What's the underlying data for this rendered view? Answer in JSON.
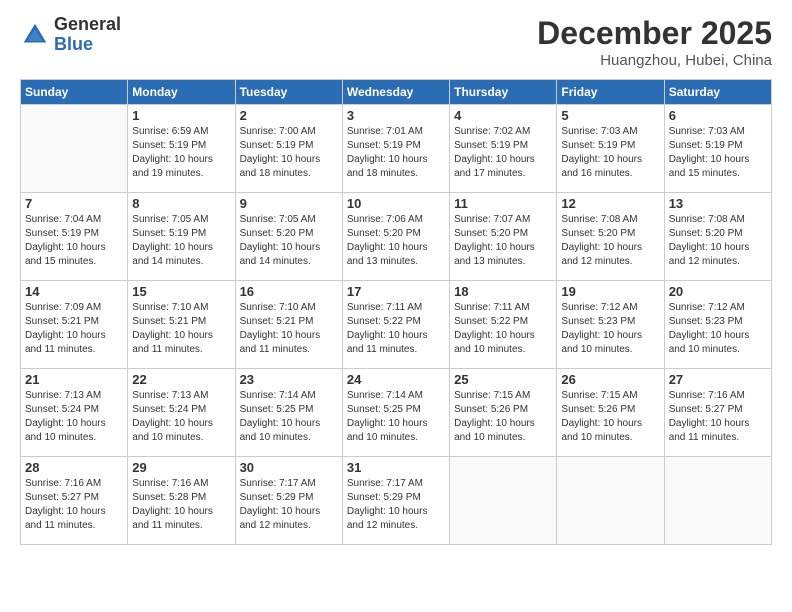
{
  "logo": {
    "general": "General",
    "blue": "Blue"
  },
  "header": {
    "month": "December 2025",
    "location": "Huangzhou, Hubei, China"
  },
  "days_of_week": [
    "Sunday",
    "Monday",
    "Tuesday",
    "Wednesday",
    "Thursday",
    "Friday",
    "Saturday"
  ],
  "weeks": [
    [
      {
        "num": "",
        "info": ""
      },
      {
        "num": "1",
        "info": "Sunrise: 6:59 AM\nSunset: 5:19 PM\nDaylight: 10 hours\nand 19 minutes."
      },
      {
        "num": "2",
        "info": "Sunrise: 7:00 AM\nSunset: 5:19 PM\nDaylight: 10 hours\nand 18 minutes."
      },
      {
        "num": "3",
        "info": "Sunrise: 7:01 AM\nSunset: 5:19 PM\nDaylight: 10 hours\nand 18 minutes."
      },
      {
        "num": "4",
        "info": "Sunrise: 7:02 AM\nSunset: 5:19 PM\nDaylight: 10 hours\nand 17 minutes."
      },
      {
        "num": "5",
        "info": "Sunrise: 7:03 AM\nSunset: 5:19 PM\nDaylight: 10 hours\nand 16 minutes."
      },
      {
        "num": "6",
        "info": "Sunrise: 7:03 AM\nSunset: 5:19 PM\nDaylight: 10 hours\nand 15 minutes."
      }
    ],
    [
      {
        "num": "7",
        "info": "Sunrise: 7:04 AM\nSunset: 5:19 PM\nDaylight: 10 hours\nand 15 minutes."
      },
      {
        "num": "8",
        "info": "Sunrise: 7:05 AM\nSunset: 5:19 PM\nDaylight: 10 hours\nand 14 minutes."
      },
      {
        "num": "9",
        "info": "Sunrise: 7:05 AM\nSunset: 5:20 PM\nDaylight: 10 hours\nand 14 minutes."
      },
      {
        "num": "10",
        "info": "Sunrise: 7:06 AM\nSunset: 5:20 PM\nDaylight: 10 hours\nand 13 minutes."
      },
      {
        "num": "11",
        "info": "Sunrise: 7:07 AM\nSunset: 5:20 PM\nDaylight: 10 hours\nand 13 minutes."
      },
      {
        "num": "12",
        "info": "Sunrise: 7:08 AM\nSunset: 5:20 PM\nDaylight: 10 hours\nand 12 minutes."
      },
      {
        "num": "13",
        "info": "Sunrise: 7:08 AM\nSunset: 5:20 PM\nDaylight: 10 hours\nand 12 minutes."
      }
    ],
    [
      {
        "num": "14",
        "info": "Sunrise: 7:09 AM\nSunset: 5:21 PM\nDaylight: 10 hours\nand 11 minutes."
      },
      {
        "num": "15",
        "info": "Sunrise: 7:10 AM\nSunset: 5:21 PM\nDaylight: 10 hours\nand 11 minutes."
      },
      {
        "num": "16",
        "info": "Sunrise: 7:10 AM\nSunset: 5:21 PM\nDaylight: 10 hours\nand 11 minutes."
      },
      {
        "num": "17",
        "info": "Sunrise: 7:11 AM\nSunset: 5:22 PM\nDaylight: 10 hours\nand 11 minutes."
      },
      {
        "num": "18",
        "info": "Sunrise: 7:11 AM\nSunset: 5:22 PM\nDaylight: 10 hours\nand 10 minutes."
      },
      {
        "num": "19",
        "info": "Sunrise: 7:12 AM\nSunset: 5:23 PM\nDaylight: 10 hours\nand 10 minutes."
      },
      {
        "num": "20",
        "info": "Sunrise: 7:12 AM\nSunset: 5:23 PM\nDaylight: 10 hours\nand 10 minutes."
      }
    ],
    [
      {
        "num": "21",
        "info": "Sunrise: 7:13 AM\nSunset: 5:24 PM\nDaylight: 10 hours\nand 10 minutes."
      },
      {
        "num": "22",
        "info": "Sunrise: 7:13 AM\nSunset: 5:24 PM\nDaylight: 10 hours\nand 10 minutes."
      },
      {
        "num": "23",
        "info": "Sunrise: 7:14 AM\nSunset: 5:25 PM\nDaylight: 10 hours\nand 10 minutes."
      },
      {
        "num": "24",
        "info": "Sunrise: 7:14 AM\nSunset: 5:25 PM\nDaylight: 10 hours\nand 10 minutes."
      },
      {
        "num": "25",
        "info": "Sunrise: 7:15 AM\nSunset: 5:26 PM\nDaylight: 10 hours\nand 10 minutes."
      },
      {
        "num": "26",
        "info": "Sunrise: 7:15 AM\nSunset: 5:26 PM\nDaylight: 10 hours\nand 10 minutes."
      },
      {
        "num": "27",
        "info": "Sunrise: 7:16 AM\nSunset: 5:27 PM\nDaylight: 10 hours\nand 11 minutes."
      }
    ],
    [
      {
        "num": "28",
        "info": "Sunrise: 7:16 AM\nSunset: 5:27 PM\nDaylight: 10 hours\nand 11 minutes."
      },
      {
        "num": "29",
        "info": "Sunrise: 7:16 AM\nSunset: 5:28 PM\nDaylight: 10 hours\nand 11 minutes."
      },
      {
        "num": "30",
        "info": "Sunrise: 7:17 AM\nSunset: 5:29 PM\nDaylight: 10 hours\nand 12 minutes."
      },
      {
        "num": "31",
        "info": "Sunrise: 7:17 AM\nSunset: 5:29 PM\nDaylight: 10 hours\nand 12 minutes."
      },
      {
        "num": "",
        "info": ""
      },
      {
        "num": "",
        "info": ""
      },
      {
        "num": "",
        "info": ""
      }
    ]
  ]
}
